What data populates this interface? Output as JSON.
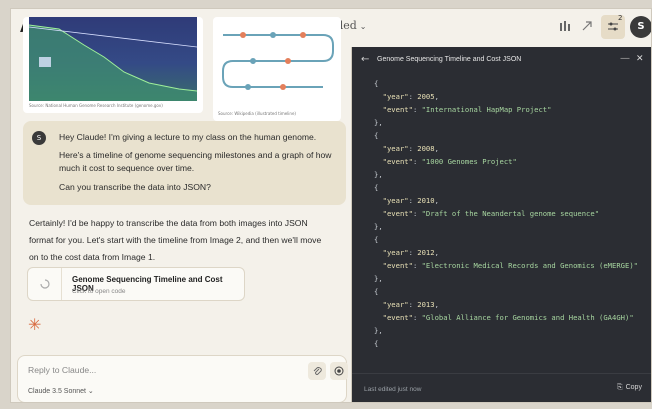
{
  "app": {
    "logo_text": "A\\",
    "new_chat_label": "+",
    "title": "Untitled",
    "title_chevron": "⌄",
    "settings_badge": "2",
    "avatar_letter": "S"
  },
  "attached_images": [
    {
      "caption": "Source: National Human Genome Research Institute (genome.gov)"
    },
    {
      "caption": "Source: Wikipedia (illustrated timeline)"
    }
  ],
  "user_message": {
    "avatar_letter": "S",
    "lines": [
      "Hey Claude! I'm giving a lecture to my class on the human genome.",
      "Here's a timeline of genome sequencing milestones and a graph of how much it cost to sequence over time.",
      "Can you transcribe the data into JSON?"
    ]
  },
  "assistant_message": {
    "text": "Certainly! I'd be happy to transcribe the data from both images into JSON format for you. Let's start with the timeline from Image 2, and then we'll move on to the cost data from Image 1.",
    "artifact": {
      "title": "Genome Sequencing Timeline and Cost JSON",
      "subtitle": "Click to open code"
    }
  },
  "composer": {
    "placeholder": "Reply to Claude...",
    "model": "Claude 3.5 Sonnet ⌄"
  },
  "code_panel": {
    "title": "Genome Sequencing Timeline and Cost JSON",
    "footer_text": "Last edited just now",
    "copy_label": "Copy",
    "entries": [
      {
        "year": 2005,
        "event": "International HapMap Project"
      },
      {
        "year": 2008,
        "event": "1000 Genomes Project"
      },
      {
        "year": 2010,
        "event": "Draft of the Neandertal genome sequence"
      },
      {
        "year": 2012,
        "event": "Electronic Medical Records and Genomics (eMERGE)"
      },
      {
        "year": 2013,
        "event": "Global Alliance for Genomics and Health (GA4GH)"
      }
    ]
  }
}
